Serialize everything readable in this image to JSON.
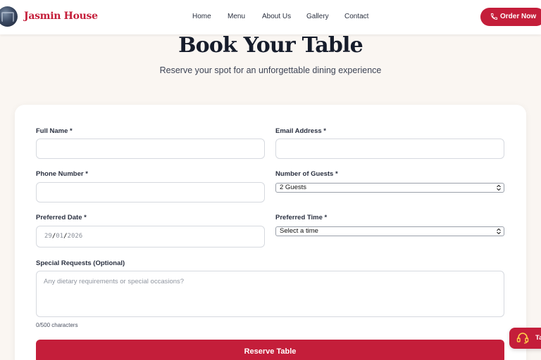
{
  "header": {
    "brand": "Jasmin House",
    "nav": [
      "Home",
      "Menu",
      "About Us",
      "Gallery",
      "Contact"
    ],
    "order_button": "Order Now"
  },
  "hero": {
    "title": "Book Your Table",
    "subtitle": "Reserve your spot for an unforgettable dining experience"
  },
  "form": {
    "full_name_label": "Full Name *",
    "email_label": "Email Address *",
    "phone_label": "Phone Number *",
    "guests_label": "Number of Guests *",
    "guests_value": "2 Guests",
    "date_label": "Preferred Date *",
    "date_day": "29",
    "date_month": "01",
    "date_year": "2026",
    "time_label": "Preferred Time *",
    "time_value": "Select a time",
    "requests_label": "Special Requests (Optional)",
    "requests_placeholder": "Any dietary requirements or special occasions?",
    "char_count": "0/500 characters",
    "submit": "Reserve Table"
  },
  "floating_button": {
    "label": "Ta",
    "icon": "headset-icon"
  },
  "colors": {
    "accent": "#c41e3a",
    "background": "#faf6f2"
  }
}
